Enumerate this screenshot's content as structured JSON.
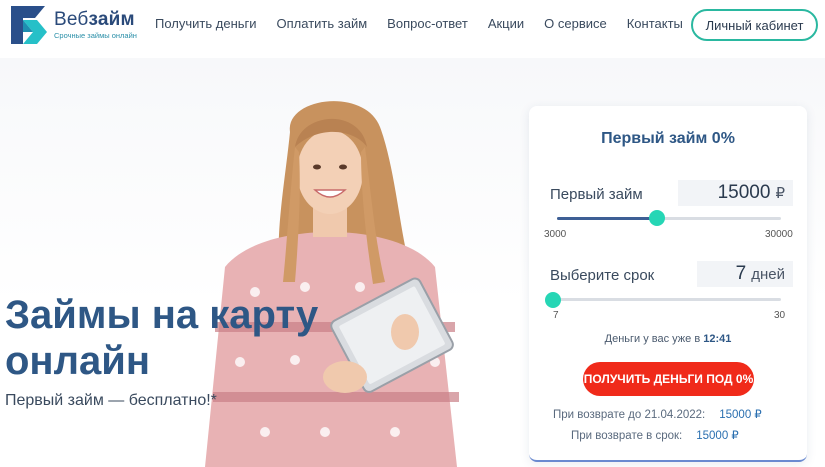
{
  "header": {
    "logo_name_light": "Веб",
    "logo_name_bold": "займ",
    "logo_sub": "Срочные займы онлайн",
    "nav": [
      "Получить деньги",
      "Оплатить займ",
      "Вопрос-ответ",
      "Акции",
      "О сервисе",
      "Контакты"
    ],
    "cabinet_label": "Личный кабинет"
  },
  "hero": {
    "title_line1": "Займы на карту",
    "title_line2": "онлайн",
    "subtitle": "Первый займ — бесплатно!*"
  },
  "calculator": {
    "title": "Первый займ 0%",
    "amount": {
      "label": "Первый займ",
      "value": "15000",
      "unit": "₽",
      "min_label": "3000",
      "max_label": "30000",
      "level": 0.4444
    },
    "term": {
      "label": "Выберите срок",
      "value": "7",
      "unit": "дней",
      "min_label": "7",
      "max_label": "30",
      "level": 0.0
    },
    "money_time_text": "Деньги у вас уже в",
    "money_time_value": "12:41",
    "cta_label": "ПОЛУЧИТЬ ДЕНЬГИ ПОД 0%",
    "return_by_label": "При возврате до 21.04.2022:",
    "return_by_amount": "15000 ₽",
    "return_on_time_label": "При возврате в срок:",
    "return_on_time_amount": "15000 ₽"
  },
  "colors": {
    "brand_blue": "#2e5785",
    "accent_teal": "#26d6b5",
    "cta_red": "#f02a1a"
  }
}
